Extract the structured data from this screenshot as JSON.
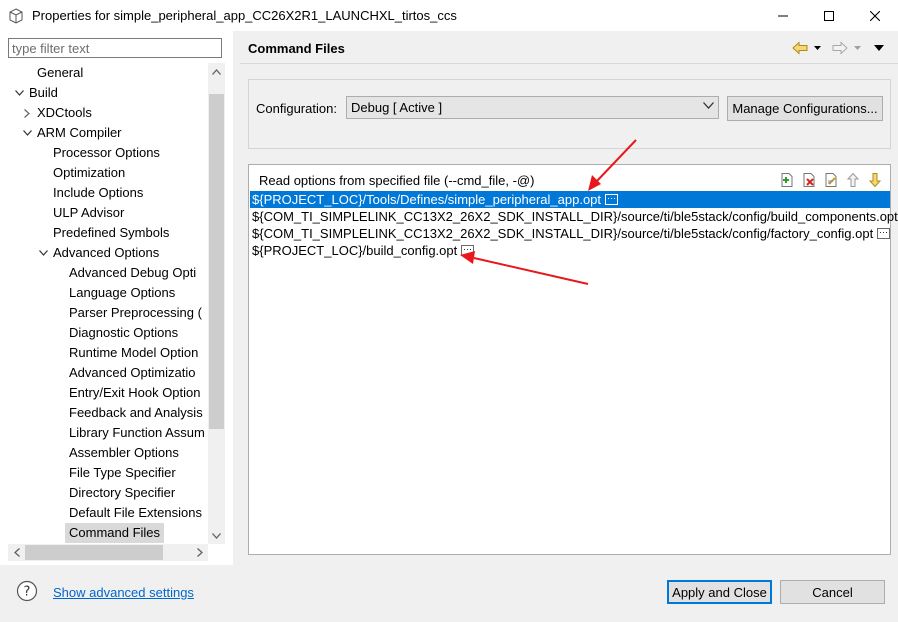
{
  "window": {
    "title": "Properties for simple_peripheral_app_CC26X2R1_LAUNCHXL_tirtos_ccs",
    "colors": {
      "accent": "#0078d7",
      "annotation": "#e8171c"
    }
  },
  "filter": {
    "placeholder": "type filter text",
    "value": ""
  },
  "tree": [
    {
      "label": "General",
      "indent": 1,
      "toggle": ""
    },
    {
      "label": "Build",
      "indent": 0,
      "toggle": "expanded"
    },
    {
      "label": "XDCtools",
      "indent": 1,
      "toggle": "collapsed"
    },
    {
      "label": "ARM Compiler",
      "indent": 1,
      "toggle": "expanded"
    },
    {
      "label": "Processor Options",
      "indent": 2,
      "toggle": ""
    },
    {
      "label": "Optimization",
      "indent": 2,
      "toggle": ""
    },
    {
      "label": "Include Options",
      "indent": 2,
      "toggle": ""
    },
    {
      "label": "ULP Advisor",
      "indent": 2,
      "toggle": ""
    },
    {
      "label": "Predefined Symbols",
      "indent": 2,
      "toggle": ""
    },
    {
      "label": "Advanced Options",
      "indent": 2,
      "toggle": "expanded"
    },
    {
      "label": "Advanced Debug Opti",
      "indent": 3,
      "toggle": ""
    },
    {
      "label": "Language Options",
      "indent": 3,
      "toggle": ""
    },
    {
      "label": "Parser Preprocessing (",
      "indent": 3,
      "toggle": ""
    },
    {
      "label": "Diagnostic Options",
      "indent": 3,
      "toggle": ""
    },
    {
      "label": "Runtime Model Option",
      "indent": 3,
      "toggle": ""
    },
    {
      "label": "Advanced Optimizatio",
      "indent": 3,
      "toggle": ""
    },
    {
      "label": "Entry/Exit Hook Option",
      "indent": 3,
      "toggle": ""
    },
    {
      "label": "Feedback and Analysis",
      "indent": 3,
      "toggle": ""
    },
    {
      "label": "Library Function Assum",
      "indent": 3,
      "toggle": ""
    },
    {
      "label": "Assembler Options",
      "indent": 3,
      "toggle": ""
    },
    {
      "label": "File Type Specifier",
      "indent": 3,
      "toggle": ""
    },
    {
      "label": "Directory Specifier",
      "indent": 3,
      "toggle": ""
    },
    {
      "label": "Default File Extensions",
      "indent": 3,
      "toggle": ""
    },
    {
      "label": "Command Files",
      "indent": 3,
      "toggle": "",
      "selected": true
    }
  ],
  "page": {
    "header": "Command Files",
    "nav_icons": [
      "back-arrow-icon",
      "back-menu-icon",
      "forward-arrow-icon",
      "forward-menu-icon",
      "view-menu-icon"
    ],
    "config_label": "Configuration:",
    "config_value": "Debug  [ Active ]",
    "manage_label": "Manage Configurations...",
    "cmd_label": "Read options from specified file (--cmd_file, -@)",
    "tool_icons": [
      "add-file-icon",
      "delete-icon",
      "edit-icon",
      "move-up-icon",
      "move-down-icon"
    ],
    "files": [
      {
        "text": "${PROJECT_LOC}/Tools/Defines/simple_peripheral_app.opt",
        "selected": true
      },
      {
        "text": "${COM_TI_SIMPLELINK_CC13X2_26X2_SDK_INSTALL_DIR}/source/ti/ble5stack/config/build_components.opt",
        "selected": false
      },
      {
        "text": "${COM_TI_SIMPLELINK_CC13X2_26X2_SDK_INSTALL_DIR}/source/ti/ble5stack/config/factory_config.opt",
        "selected": false
      },
      {
        "text": "${PROJECT_LOC}/build_config.opt",
        "selected": false
      }
    ]
  },
  "footer": {
    "help_icon": "help-icon",
    "advanced_link": "Show advanced settings",
    "apply_label": "Apply and Close",
    "cancel_label": "Cancel"
  }
}
